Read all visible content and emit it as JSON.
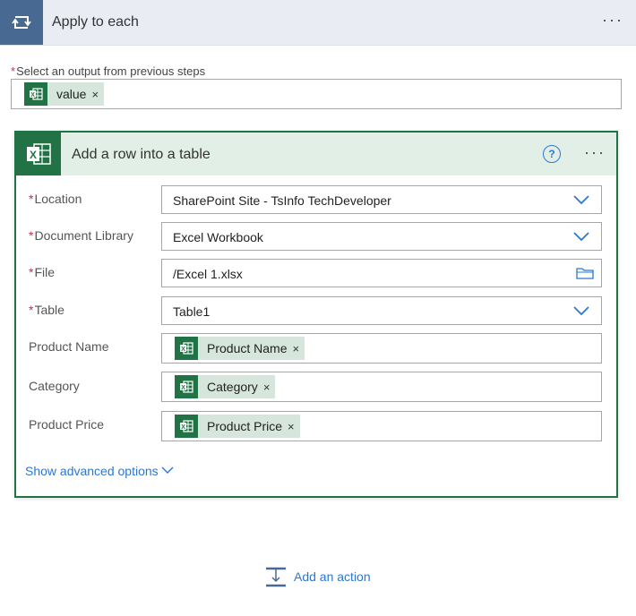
{
  "loop": {
    "title": "Apply to each",
    "icon": "loop-icon",
    "more_label": "···",
    "output_label": "Select an output from previous steps",
    "output_token": {
      "label": "value",
      "icon": "excel-icon",
      "remove": "×"
    }
  },
  "action": {
    "title": "Add a row into a table",
    "icon": "excel-icon",
    "help_label": "?",
    "more_label": "···",
    "fields": [
      {
        "label": "Location",
        "required": true,
        "value": "SharePoint Site - TsInfo TechDeveloper",
        "control": "dropdown"
      },
      {
        "label": "Document Library",
        "required": true,
        "value": "Excel Workbook",
        "control": "dropdown"
      },
      {
        "label": "File",
        "required": true,
        "value": "/Excel 1.xlsx",
        "control": "folder-picker"
      },
      {
        "label": "Table",
        "required": true,
        "value": "Table1",
        "control": "dropdown"
      },
      {
        "label": "Product Name",
        "required": false,
        "token": "Product Name",
        "control": "token"
      },
      {
        "label": "Category",
        "required": false,
        "token": "Category",
        "control": "token"
      },
      {
        "label": "Product Price",
        "required": false,
        "token": "Product Price",
        "control": "token"
      }
    ],
    "token_remove": "×",
    "advanced_label": "Show advanced options"
  },
  "footer": {
    "add_action_label": "Add an action"
  },
  "colors": {
    "loop_accent": "#486991",
    "excel_green": "#217346",
    "link_blue": "#2b77d3",
    "required_red": "#c4314b"
  }
}
